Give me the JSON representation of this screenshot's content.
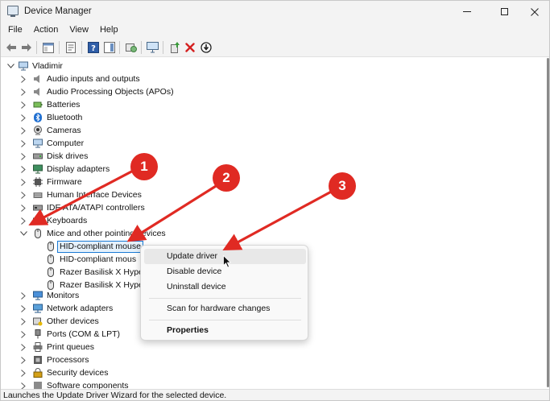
{
  "window": {
    "title": "Device Manager",
    "controls": {
      "minimize": "—",
      "maximize": "☐",
      "close": "✕"
    }
  },
  "menu": [
    "File",
    "Action",
    "View",
    "Help"
  ],
  "toolbar": {
    "buttons": [
      "back-arrow-icon",
      "forward-arrow-icon",
      "show-hide-console-tree-icon",
      "properties-icon",
      "help-icon",
      "action-pane-icon",
      "scan-hardware-icon",
      "update-driver-icon",
      "uninstall-device-icon",
      "disable-device-icon"
    ]
  },
  "tree": {
    "root": "Vladimir",
    "categories": [
      "Audio inputs and outputs",
      "Audio Processing Objects (APOs)",
      "Batteries",
      "Bluetooth",
      "Cameras",
      "Computer",
      "Disk drives",
      "Display adapters",
      "Firmware",
      "Human Interface Devices",
      "IDE ATA/ATAPI controllers",
      "Keyboards",
      "Mice and other pointing devices"
    ],
    "mice_children": [
      "HID-compliant mouse",
      "HID-compliant mous",
      "Razer Basilisk X Hyper",
      "Razer Basilisk X Hyper"
    ],
    "categories_after": [
      "Monitors",
      "Network adapters",
      "Other devices",
      "Ports (COM & LPT)",
      "Print queues",
      "Processors",
      "Security devices",
      "Software components"
    ]
  },
  "context_menu": {
    "items": [
      "Update driver",
      "Disable device",
      "Uninstall device",
      "Scan for hardware changes",
      "Properties"
    ],
    "hovered": "Update driver"
  },
  "status_bar": "Launches the Update Driver Wizard for the selected device.",
  "annotations": {
    "badges": [
      "1",
      "2",
      "3"
    ],
    "color": "#e02a23"
  },
  "colors": {
    "selection_border": "#1a7ad4",
    "selection_fill": "#e5f1fb",
    "annotation_red": "#e02a23",
    "close_red": "#d42020"
  }
}
